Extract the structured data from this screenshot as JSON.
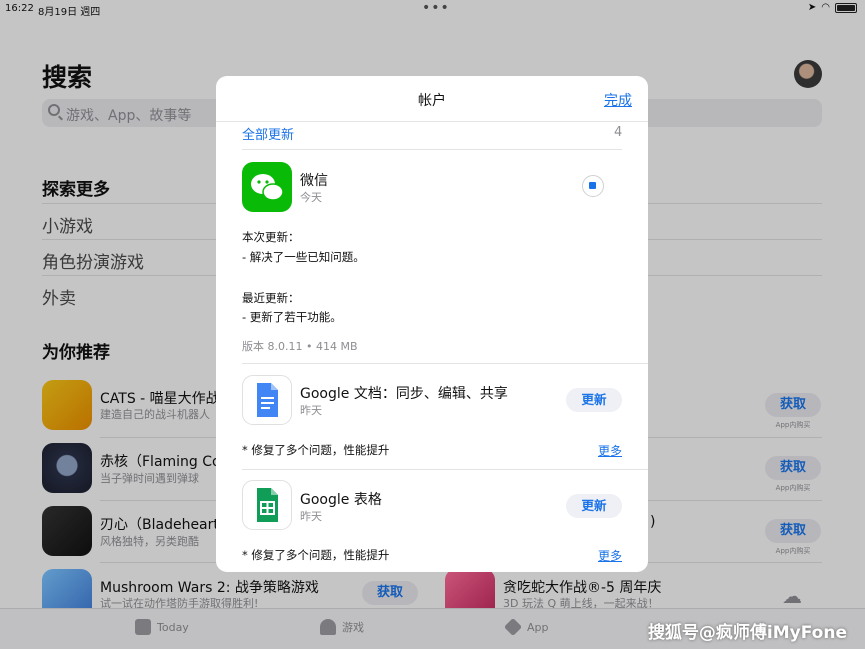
{
  "status_bar": {
    "time": "16:22",
    "date": "8月19日 週四",
    "icons": "wifi battery"
  },
  "page": {
    "title": "搜索",
    "search_placeholder": "游戏、App、故事等"
  },
  "explore": {
    "title": "探索更多",
    "items": [
      {
        "label": "小游戏"
      },
      {
        "label": "角色扮演游戏"
      },
      {
        "label": "外卖"
      }
    ]
  },
  "recommend": {
    "title": "为你推荐",
    "apps": [
      {
        "name": "CATS - 喵星大作战",
        "sub": "建造自己的战斗机器人",
        "button": "获取",
        "note": "App内购买"
      },
      {
        "name": "赤核（Flaming Core）",
        "sub": "当子弹时间遇到弹球",
        "button": "获取",
        "note": "App内购买"
      },
      {
        "name": "刃心（Bladeheart N…",
        "sub": "风格独特，另类跑酷",
        "button": "获取",
        "note": "App内购买"
      },
      {
        "name": "Mushroom Wars 2: 战争策略游戏",
        "sub": "试一试在动作塔防手游取得胜利!",
        "button": "获取"
      }
    ],
    "right_app": {
      "name": "贪吃蛇大作战®-5 周年庆",
      "sub": "3D 玩法 Q 萌上线，一起来战！"
    },
    "hidden_fragment": ")"
  },
  "tabs": [
    {
      "label": "Today"
    },
    {
      "label": "游戏"
    },
    {
      "label": "App"
    }
  ],
  "watermark": "搜狐号@疯师傅iMyFone",
  "modal": {
    "title": "帐户",
    "done": "完成",
    "update_all": "全部更新",
    "update_count": "4",
    "wechat": {
      "name": "微信",
      "date": "今天",
      "notes_title": "本次更新：",
      "notes_item": "- 解决了一些已知问题。",
      "recent_title": "最近更新：",
      "recent_item": "- 更新了若干功能。",
      "version": "版本 8.0.11 • 414 MB"
    },
    "gdocs": {
      "name": "Google 文档：同步、编辑、共享",
      "date": "昨天",
      "button": "更新",
      "note": "* 修复了多个问题，性能提升",
      "more": "更多"
    },
    "gsheets": {
      "name": "Google 表格",
      "date": "昨天",
      "button": "更新",
      "note": "* 修复了多个问题，性能提升",
      "more": "更多"
    }
  },
  "colors": {
    "accent": "#1a73e8",
    "wechat_green": "#09bb07",
    "docs_blue": "#4285f4",
    "sheets_green": "#0f9d58"
  }
}
